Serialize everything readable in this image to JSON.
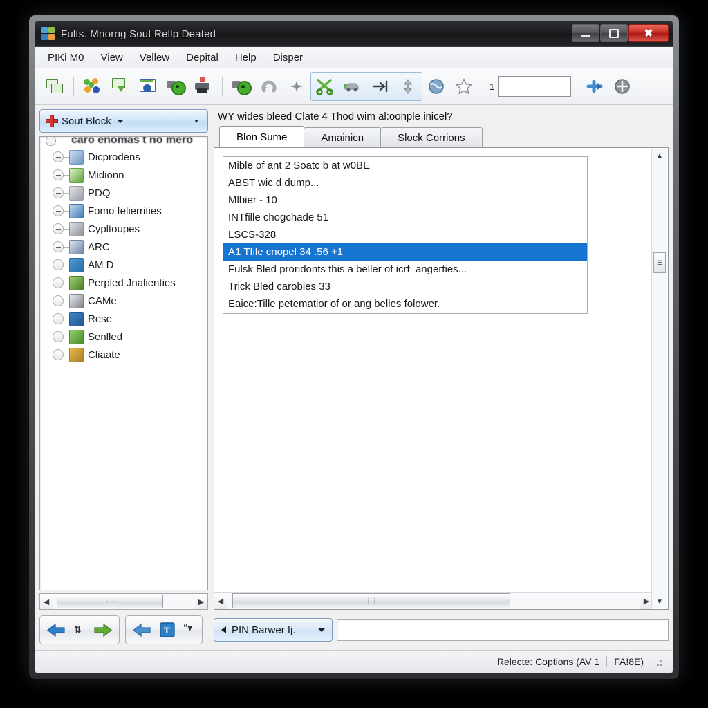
{
  "window": {
    "title": "Fults. Mriorrig Sout Rellp Deated",
    "icon": "app-squares-icon",
    "controls": {
      "minimize": "minimize-icon",
      "maximize": "maximize-icon",
      "close": "close-icon"
    }
  },
  "menubar": {
    "items": [
      "PIKi M0",
      "View",
      "Vellew",
      "Depital",
      "Help",
      "Disper"
    ]
  },
  "toolbar": {
    "field_value": "",
    "number_label": "1",
    "buttons": [
      {
        "name": "copy-windows-icon",
        "label": ""
      },
      {
        "name": "colored-nodes-icon",
        "label": ""
      },
      {
        "name": "import-green-icon",
        "label": ""
      },
      {
        "name": "window-refresh-icon",
        "label": ""
      },
      {
        "name": "camera-record-icon",
        "label": ""
      },
      {
        "name": "printer-icon",
        "label": ""
      },
      {
        "name": "record-play-icon",
        "label": ""
      },
      {
        "name": "undo-arrow-icon",
        "label": ""
      },
      {
        "name": "sparkle-icon",
        "label": ""
      },
      {
        "name": "scissors-green-icon",
        "label": ""
      },
      {
        "name": "car-arrow-icon",
        "label": ""
      },
      {
        "name": "updown-arrow-icon",
        "label": ""
      },
      {
        "name": "globe-icon",
        "label": ""
      },
      {
        "name": "star-icon",
        "label": ""
      },
      {
        "name": "blue-plus-arrow-icon",
        "label": ""
      },
      {
        "name": "move-circle-icon",
        "label": ""
      }
    ]
  },
  "sidebar": {
    "block_button": {
      "label": "Sout Block",
      "icon": "red-plus-icon"
    },
    "tree_root": "caro enomas t no mero",
    "items": [
      {
        "label": "Dicprodens",
        "icon": "folder-image-icon"
      },
      {
        "label": "Midionn",
        "icon": "green-leaf-icon"
      },
      {
        "label": "PDQ",
        "icon": "gray-square-icon"
      },
      {
        "label": "Fomo felierrities",
        "icon": "blue-photo-icon"
      },
      {
        "label": "Cypltoupes",
        "icon": "gray-stack-icon"
      },
      {
        "label": "ARC",
        "icon": "pen-square-icon"
      },
      {
        "label": "AM D",
        "icon": "blue-star-icon"
      },
      {
        "label": "Perpled Jnalienties",
        "icon": "green-pencil-icon"
      },
      {
        "label": "CAMe",
        "icon": "door-icon"
      },
      {
        "label": "Rese",
        "icon": "blue-doc-icon"
      },
      {
        "label": "Senlled",
        "icon": "green-map-icon"
      },
      {
        "label": "Cliaate",
        "icon": "yellow-folder-icon"
      }
    ],
    "nav": {
      "back": "back-arrow-icon",
      "refresh": "refresh-icon",
      "forward": "forward-arrow-icon",
      "undo": "undo-back-icon",
      "text_tool": "text-tool-icon",
      "quotes": "quotes-icon"
    }
  },
  "main": {
    "caption": "WY wides bleed Clate 4 Thod wim al:oonple inicel?",
    "tabs": [
      {
        "label": "Blon Sume",
        "selected": true
      },
      {
        "label": "Amainicn",
        "selected": false
      },
      {
        "label": "Slock Corrions",
        "selected": false
      }
    ],
    "list_items": [
      {
        "text": "Mible of ant 2 Soatc b at w0BE",
        "selected": false
      },
      {
        "text": "ABST wic d dump...",
        "selected": false
      },
      {
        "text": "Mlbier - 10",
        "selected": false
      },
      {
        "text": "INTfille chogchade 51",
        "selected": false
      },
      {
        "text": "LSCS-328",
        "selected": false
      },
      {
        "text": "A1 Tfile cnopel 34 .56  +1",
        "selected": true
      },
      {
        "text": "Fulsk Bled proridonts this a beller of icrf_angerties...",
        "selected": false
      },
      {
        "text": "Trick Bled carobles 33",
        "selected": false
      },
      {
        "text": "Eaice:Tille petematlor of or ang belies folower.",
        "selected": false
      }
    ],
    "pin_dropdown": {
      "label": "PIN Barwer Ij.",
      "arrow": "left-arrow-icon"
    },
    "bottom_field_value": ""
  },
  "statusbar": {
    "left_text": "Relecte: Coptions (AV  1",
    "right_text": "FA!8E)"
  },
  "colors": {
    "selection_blue": "#1675d1",
    "accent_blue": "#7d9dc0",
    "close_red": "#c62b22",
    "plus_red": "#d03a32"
  }
}
